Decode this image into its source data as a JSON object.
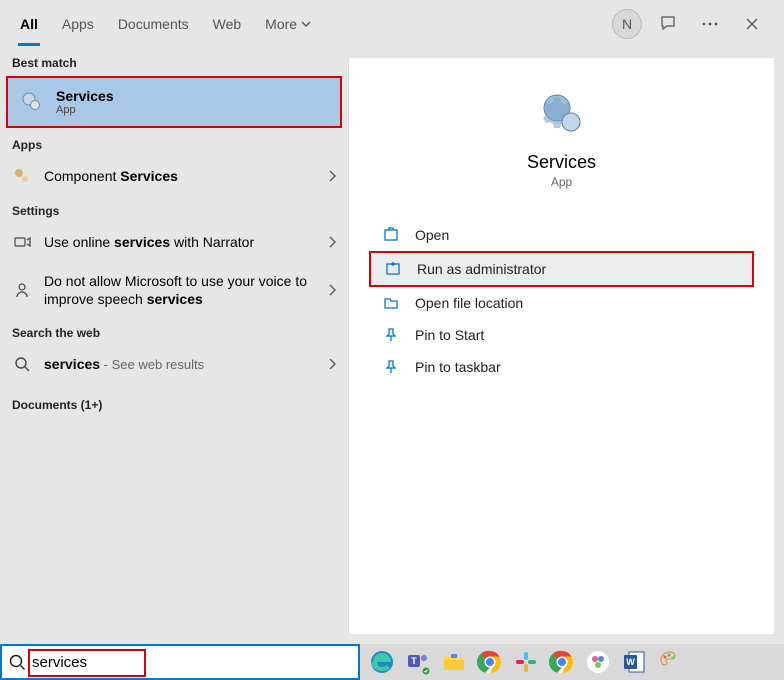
{
  "tabs": [
    "All",
    "Apps",
    "Documents",
    "Web",
    "More"
  ],
  "active_tab": 0,
  "user_initial": "N",
  "left": {
    "best_match_header": "Best match",
    "best_match": {
      "title": "Services",
      "subtitle": "App"
    },
    "apps_header": "Apps",
    "apps": [
      {
        "prefix": "Component ",
        "bold": "Services"
      }
    ],
    "settings_header": "Settings",
    "settings": [
      {
        "prefix": "Use online ",
        "bold": "services",
        "suffix": " with Narrator"
      },
      {
        "prefix": "Do not allow Microsoft to use your voice to improve speech ",
        "bold": "services",
        "suffix": ""
      }
    ],
    "web_header": "Search the web",
    "web": {
      "bold": "services",
      "suffix": " - See web results"
    },
    "documents_header": "Documents (1+)"
  },
  "right": {
    "title": "Services",
    "subtitle": "App",
    "actions": [
      "Open",
      "Run as administrator",
      "Open file location",
      "Pin to Start",
      "Pin to taskbar"
    ]
  },
  "search_value": "services"
}
